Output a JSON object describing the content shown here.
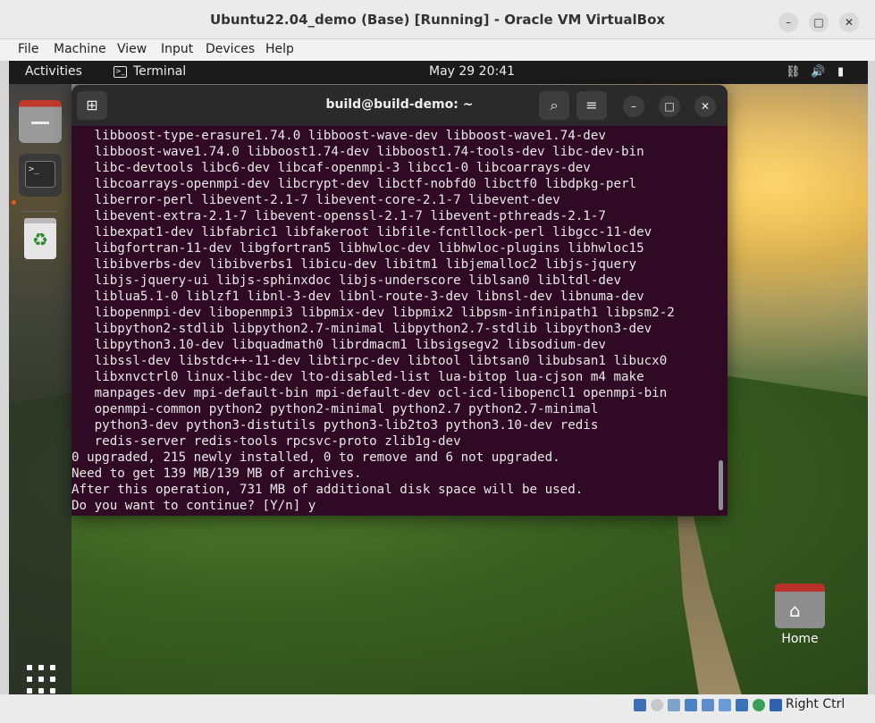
{
  "window": {
    "title": "Ubuntu22.04_demo (Base) [Running] - Oracle VM VirtualBox"
  },
  "menu": [
    "File",
    "Machine",
    "View",
    "Input",
    "Devices",
    "Help"
  ],
  "topbar": {
    "activities": "Activities",
    "app": "Terminal",
    "clock": "May 29  20:41"
  },
  "terminal": {
    "title": "build@build-demo: ~",
    "lines": [
      "   libboost-type-erasure1.74.0 libboost-wave-dev libboost-wave1.74-dev",
      "   libboost-wave1.74.0 libboost1.74-dev libboost1.74-tools-dev libc-dev-bin",
      "   libc-devtools libc6-dev libcaf-openmpi-3 libcc1-0 libcoarrays-dev",
      "   libcoarrays-openmpi-dev libcrypt-dev libctf-nobfd0 libctf0 libdpkg-perl",
      "   liberror-perl libevent-2.1-7 libevent-core-2.1-7 libevent-dev",
      "   libevent-extra-2.1-7 libevent-openssl-2.1-7 libevent-pthreads-2.1-7",
      "   libexpat1-dev libfabric1 libfakeroot libfile-fcntllock-perl libgcc-11-dev",
      "   libgfortran-11-dev libgfortran5 libhwloc-dev libhwloc-plugins libhwloc15",
      "   libibverbs-dev libibverbs1 libicu-dev libitm1 libjemalloc2 libjs-jquery",
      "   libjs-jquery-ui libjs-sphinxdoc libjs-underscore liblsan0 libltdl-dev",
      "   liblua5.1-0 liblzf1 libnl-3-dev libnl-route-3-dev libnsl-dev libnuma-dev",
      "   libopenmpi-dev libopenmpi3 libpmix-dev libpmix2 libpsm-infinipath1 libpsm2-2",
      "   libpython2-stdlib libpython2.7-minimal libpython2.7-stdlib libpython3-dev",
      "   libpython3.10-dev libquadmath0 librdmacm1 libsigsegv2 libsodium-dev",
      "   libssl-dev libstdc++-11-dev libtirpc-dev libtool libtsan0 libubsan1 libucx0",
      "   libxnvctrl0 linux-libc-dev lto-disabled-list lua-bitop lua-cjson m4 make",
      "   manpages-dev mpi-default-bin mpi-default-dev ocl-icd-libopencl1 openmpi-bin",
      "   openmpi-common python2 python2-minimal python2.7 python2.7-minimal",
      "   python3-dev python3-distutils python3-lib2to3 python3.10-dev redis",
      "   redis-server redis-tools rpcsvc-proto zlib1g-dev",
      "0 upgraded, 215 newly installed, 0 to remove and 6 not upgraded.",
      "Need to get 139 MB/139 MB of archives.",
      "After this operation, 731 MB of additional disk space will be used.",
      "Do you want to continue? [Y/n] y"
    ]
  },
  "desktop": {
    "home_label": "Home"
  },
  "status": {
    "host_key": "Right Ctrl"
  },
  "colors": {
    "terminal_bg": "#300a24",
    "accent": "#e95420"
  }
}
